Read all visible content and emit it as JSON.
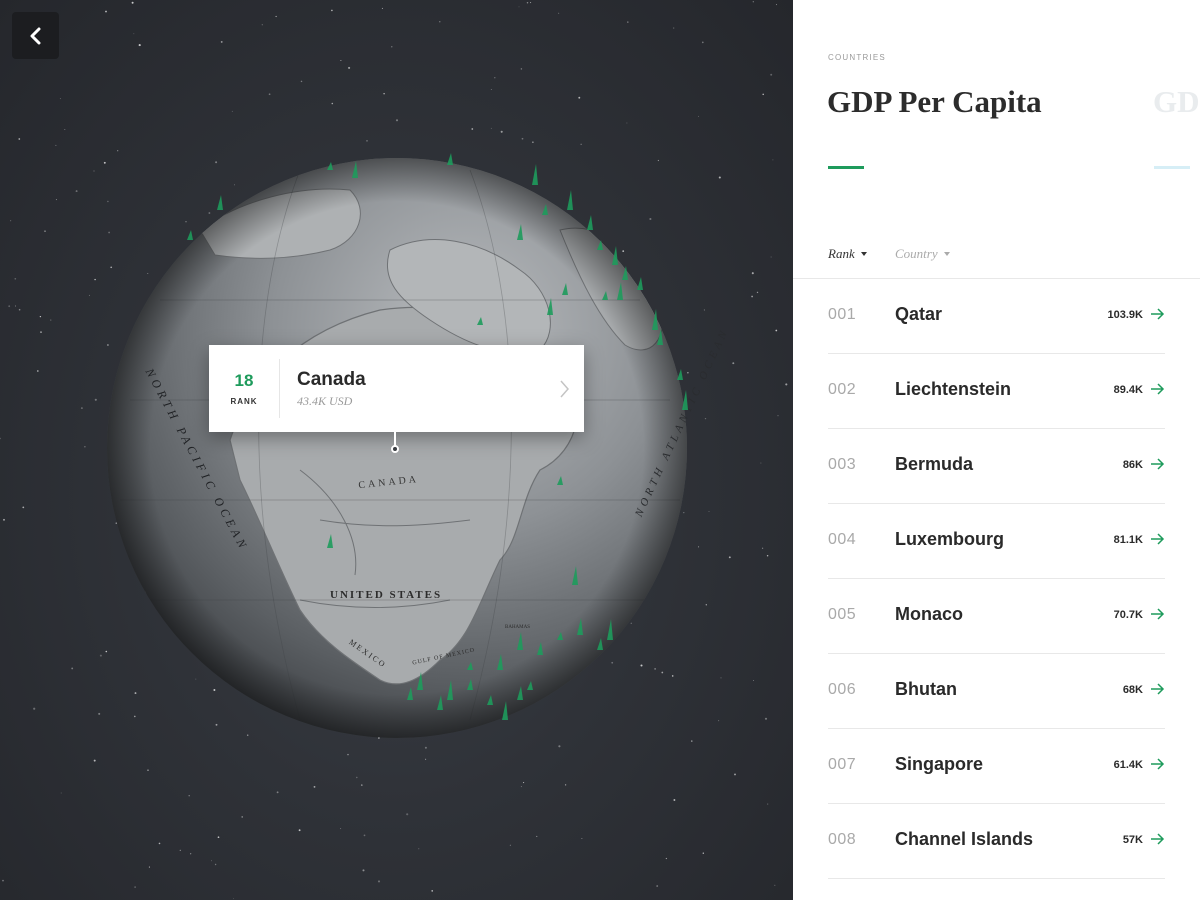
{
  "nav": {
    "back_icon": "chevron-left-icon"
  },
  "tooltip": {
    "rank": "18",
    "rank_label": "RANK",
    "country": "Canada",
    "value": "43.4K USD",
    "chevron_icon": "chevron-right-icon"
  },
  "globe": {
    "labels": {
      "canada": "CANADA",
      "united_states": "UNITED STATES",
      "north_pacific": "NORTH PACIFIC OCEAN",
      "north_atlantic": "NORTH ATLANTIC OCEAN",
      "mexico": "MEXICO",
      "gulf_of_mexico": "GULF OF MEXICO",
      "bahamas": "BAHAMAS"
    }
  },
  "panel": {
    "eyebrow": "COUNTRIES",
    "title": "GDP Per Capita",
    "title_next": "GDP",
    "sort": {
      "rank_label": "Rank",
      "country_label": "Country"
    },
    "rows": [
      {
        "rank": "001",
        "country": "Qatar",
        "value": "103.9K"
      },
      {
        "rank": "002",
        "country": "Liechtenstein",
        "value": "89.4K"
      },
      {
        "rank": "003",
        "country": "Bermuda",
        "value": "86K"
      },
      {
        "rank": "004",
        "country": "Luxembourg",
        "value": "81.1K"
      },
      {
        "rank": "005",
        "country": "Monaco",
        "value": "70.7K"
      },
      {
        "rank": "006",
        "country": "Bhutan",
        "value": "68K"
      },
      {
        "rank": "007",
        "country": "Singapore",
        "value": "61.4K"
      },
      {
        "rank": "008",
        "country": "Channel Islands",
        "value": "57K"
      }
    ]
  },
  "colors": {
    "accent": "#1e9b5c",
    "space": "#2b2e33",
    "panel": "#ffffff"
  }
}
